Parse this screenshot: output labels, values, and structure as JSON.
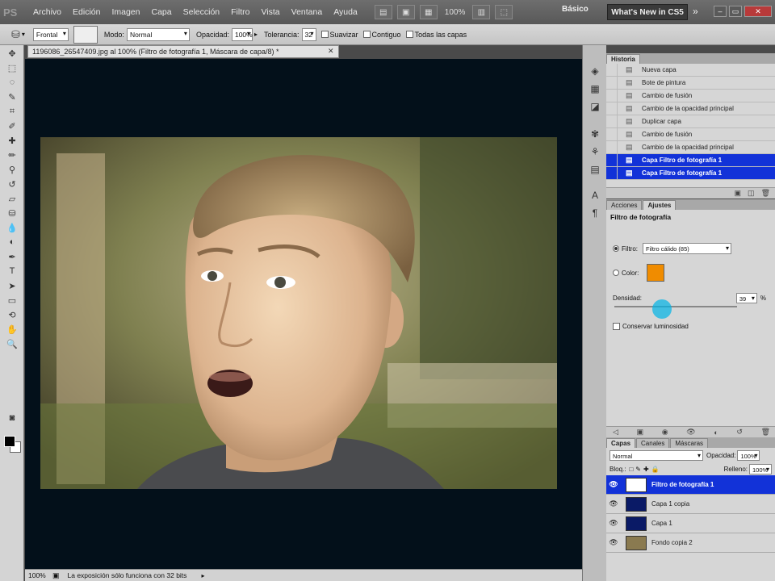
{
  "menubar": {
    "logo": "PS",
    "items": [
      "Archivo",
      "Edición",
      "Imagen",
      "Capa",
      "Selección",
      "Filtro",
      "Vista",
      "Ventana",
      "Ayuda"
    ],
    "zoom": "100%",
    "workspace": "Básico",
    "whats_new": "What's New in CS5"
  },
  "options": {
    "mode_select_value": "Frontal",
    "modo_label": "Modo:",
    "modo_value": "Normal",
    "opacidad_label": "Opacidad:",
    "opacidad_value": "100%",
    "tolerancia_label": "Tolerancia:",
    "tolerancia_value": "32",
    "suavizar_label": "Suavizar",
    "contiguo_label": "Contiguo",
    "todas_capas_label": "Todas las capas"
  },
  "document": {
    "tab_title": "1196086_26547409.jpg al 100% (Filtro de fotografía 1, Máscara de capa/8) *",
    "status_zoom": "100%",
    "status_text": "La exposición sólo funciona con 32 bits"
  },
  "history": {
    "tab": "Historia",
    "items": [
      {
        "label": "Nueva capa",
        "selected": false
      },
      {
        "label": "Bote de pintura",
        "selected": false
      },
      {
        "label": "Cambio de fusión",
        "selected": false
      },
      {
        "label": "Cambio de la opacidad principal",
        "selected": false
      },
      {
        "label": "Duplicar capa",
        "selected": false
      },
      {
        "label": "Cambio de fusión",
        "selected": false
      },
      {
        "label": "Cambio de la opacidad principal",
        "selected": false
      },
      {
        "label": "Capa Filtro de fotografía 1",
        "selected": true
      },
      {
        "label": "Capa Filtro de fotografía 1",
        "selected": true
      }
    ]
  },
  "adjustments": {
    "tabs": [
      "Acciones",
      "Ajustes"
    ],
    "title": "Filtro de fotografía",
    "filtro_label": "Filtro:",
    "filtro_value": "Filtro cálido (85)",
    "color_label": "Color:",
    "color_swatch": "#f08c00",
    "densidad_label": "Densidad:",
    "densidad_value": "39",
    "densidad_unit": "%",
    "densidad_level": 0.39,
    "conservar_label": "Conservar luminosidad"
  },
  "layers": {
    "tabs": [
      "Capas",
      "Canales",
      "Máscaras"
    ],
    "blend_mode": "Normal",
    "opacidad_label": "Opacidad:",
    "opacidad_value": "100%",
    "bloq_label": "Bloq.:",
    "relleno_label": "Relleno:",
    "relleno_value": "100%",
    "items": [
      {
        "label": "Filtro de fotografía 1",
        "selected": true,
        "color": "#ffffff"
      },
      {
        "label": "Capa 1 copia",
        "selected": false,
        "color": "#0a1a66"
      },
      {
        "label": "Capa 1",
        "selected": false,
        "color": "#0a1a66"
      },
      {
        "label": "Fondo copia 2",
        "selected": false,
        "color": "#8a7a50"
      }
    ]
  }
}
